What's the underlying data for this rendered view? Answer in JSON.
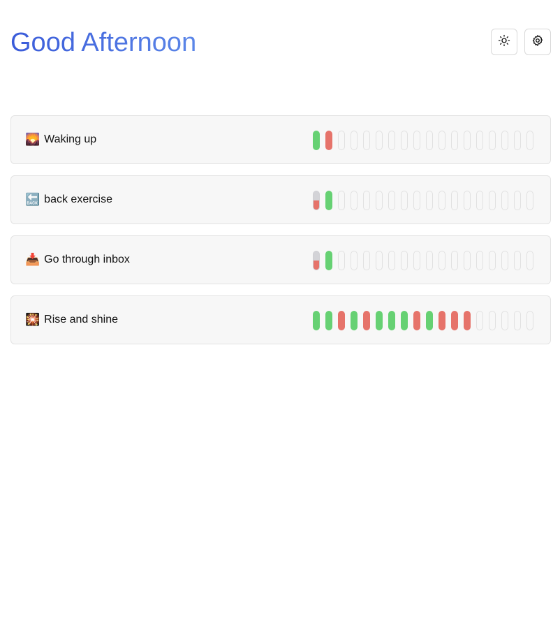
{
  "header": {
    "title": "Good Afternoon",
    "theme_icon": "sun-icon",
    "settings_icon": "gear-icon"
  },
  "colors": {
    "done": "#66d173",
    "missed": "#e6736a",
    "empty_border": "#e1e1e1",
    "title_gradient_start": "#3a5bd9",
    "title_gradient_end": "#5b86e8"
  },
  "habits": [
    {
      "emoji": "🌄",
      "name": "Waking up",
      "days": [
        "done",
        "missed",
        "empty",
        "empty",
        "empty",
        "empty",
        "empty",
        "empty",
        "empty",
        "empty",
        "empty",
        "empty",
        "empty",
        "empty",
        "empty",
        "empty",
        "empty",
        "empty"
      ]
    },
    {
      "emoji": "🔙",
      "name": "back exercise",
      "days": [
        "partial",
        "done",
        "empty",
        "empty",
        "empty",
        "empty",
        "empty",
        "empty",
        "empty",
        "empty",
        "empty",
        "empty",
        "empty",
        "empty",
        "empty",
        "empty",
        "empty",
        "empty"
      ]
    },
    {
      "emoji": "📥",
      "name": "Go through inbox",
      "days": [
        "partial",
        "done",
        "empty",
        "empty",
        "empty",
        "empty",
        "empty",
        "empty",
        "empty",
        "empty",
        "empty",
        "empty",
        "empty",
        "empty",
        "empty",
        "empty",
        "empty",
        "empty"
      ]
    },
    {
      "emoji": "🎇",
      "name": "Rise and shine",
      "days": [
        "done",
        "done",
        "missed",
        "done",
        "missed",
        "done",
        "done",
        "done",
        "missed",
        "done",
        "missed",
        "missed",
        "missed",
        "empty",
        "empty",
        "empty",
        "empty",
        "empty"
      ]
    }
  ]
}
